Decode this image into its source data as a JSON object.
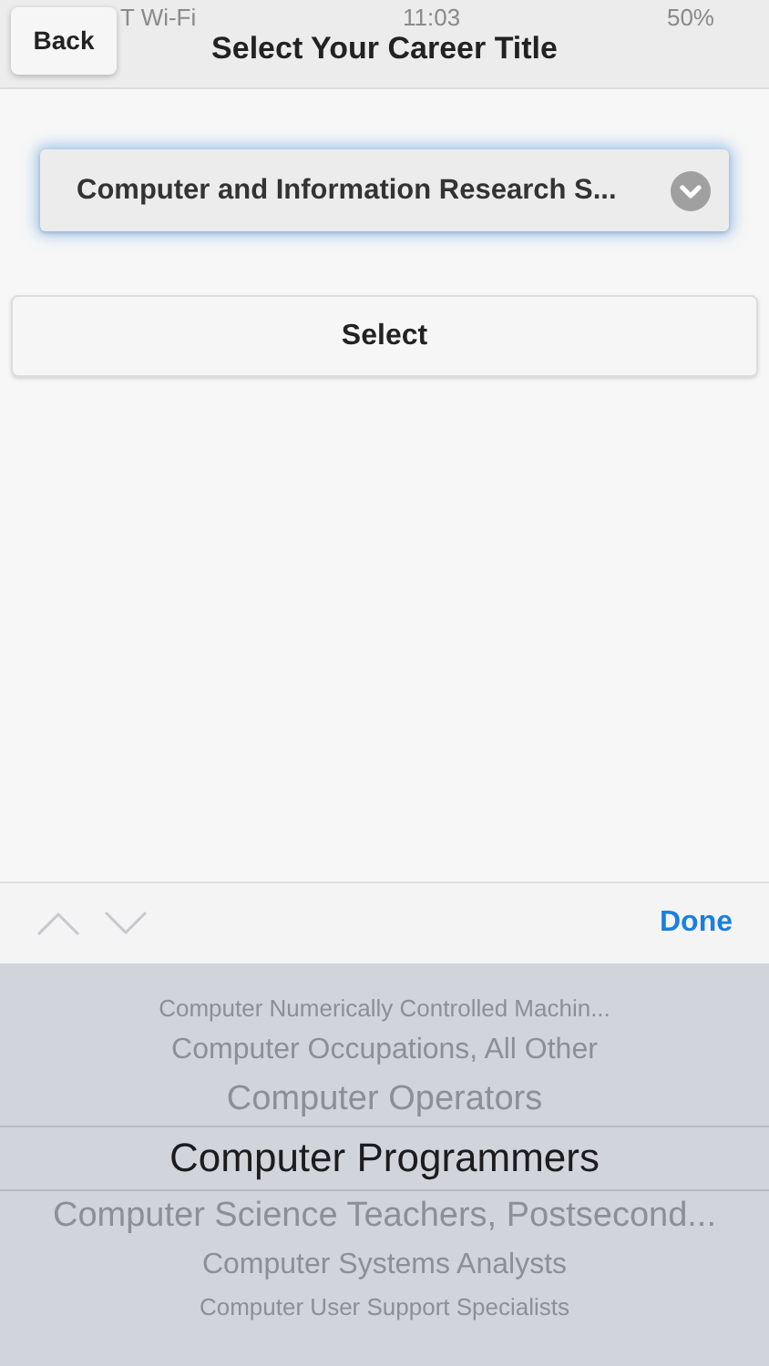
{
  "status_bar": {
    "carrier": "T Wi-Fi",
    "time": "11:03",
    "battery": "50%"
  },
  "nav": {
    "back": "Back",
    "title": "Select Your Career Title"
  },
  "dropdown": {
    "value": "Computer and Information Research S..."
  },
  "select_button": "Select",
  "toolbar": {
    "done": "Done"
  },
  "picker": [
    {
      "label": "Computer Numerically Controlled Machin...",
      "selected": false
    },
    {
      "label": "Computer Occupations, All Other",
      "selected": false
    },
    {
      "label": "Computer Operators",
      "selected": false
    },
    {
      "label": "Computer Programmers",
      "selected": true
    },
    {
      "label": "Computer Science Teachers, Postsecond...",
      "selected": false
    },
    {
      "label": "Computer Systems Analysts",
      "selected": false
    },
    {
      "label": "Computer User Support Specialists",
      "selected": false
    }
  ]
}
